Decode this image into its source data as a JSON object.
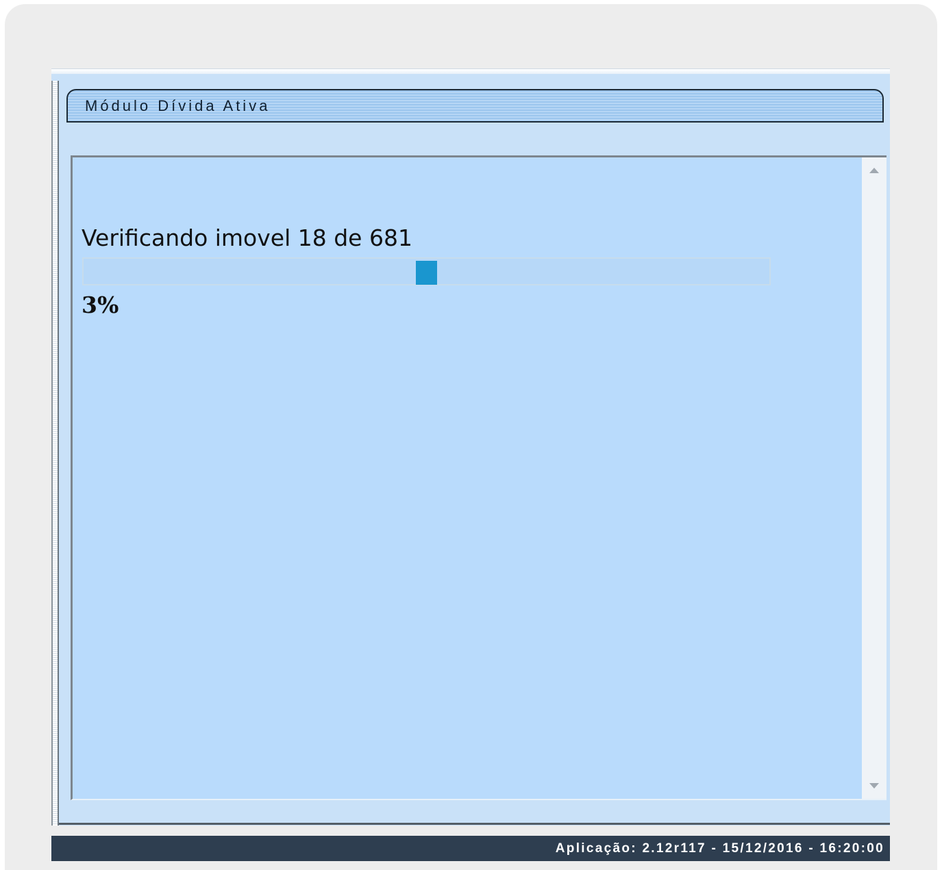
{
  "module": {
    "title": "Módulo Dívida Ativa"
  },
  "progress": {
    "message": "Verificando imovel 18 de 681",
    "current": 18,
    "total": 681,
    "percent_label": "3%",
    "percent": 3,
    "bar_color": "#1a96cf"
  },
  "status_bar": {
    "text": "Aplicação: 2.12r117 - 15/12/2016 - 16:20:00"
  },
  "scrollbar": {
    "up_icon": "triangle-up",
    "down_icon": "triangle-down"
  },
  "colors": {
    "panel_background": "#b9dbfc",
    "status_bar_background": "#2e3e50",
    "title_tab_background": "#9cc6ee"
  }
}
